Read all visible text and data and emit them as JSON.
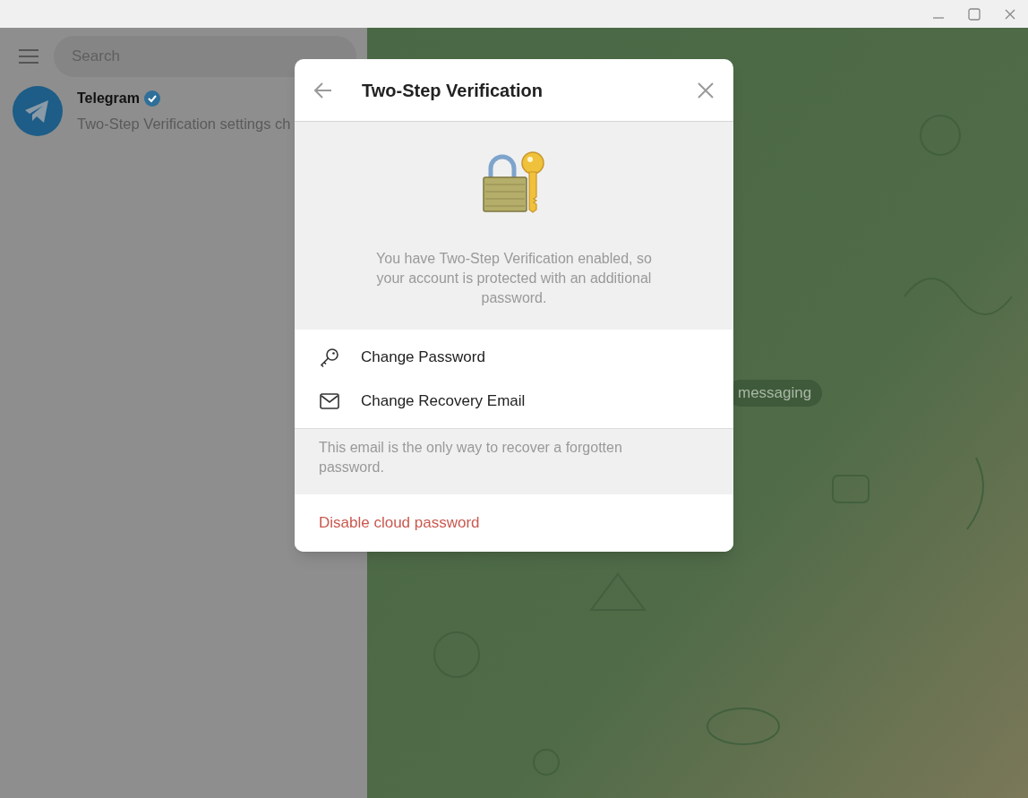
{
  "sidebar": {
    "search": {
      "placeholder": "Search"
    },
    "chats": [
      {
        "name": "Telegram",
        "verified": true,
        "preview": "Two-Step Verification settings ch"
      }
    ]
  },
  "chat": {
    "service_pill": "messaging"
  },
  "dialog": {
    "title": "Two-Step Verification",
    "description": "You have Two-Step Verification enabled, so your account is protected with an additional password.",
    "actions": [
      {
        "kind": "key",
        "label": "Change Password"
      },
      {
        "kind": "mail",
        "label": "Change Recovery Email"
      }
    ],
    "note": "This email is the only way to recover a forgotten password.",
    "danger_action": "Disable cloud password"
  }
}
